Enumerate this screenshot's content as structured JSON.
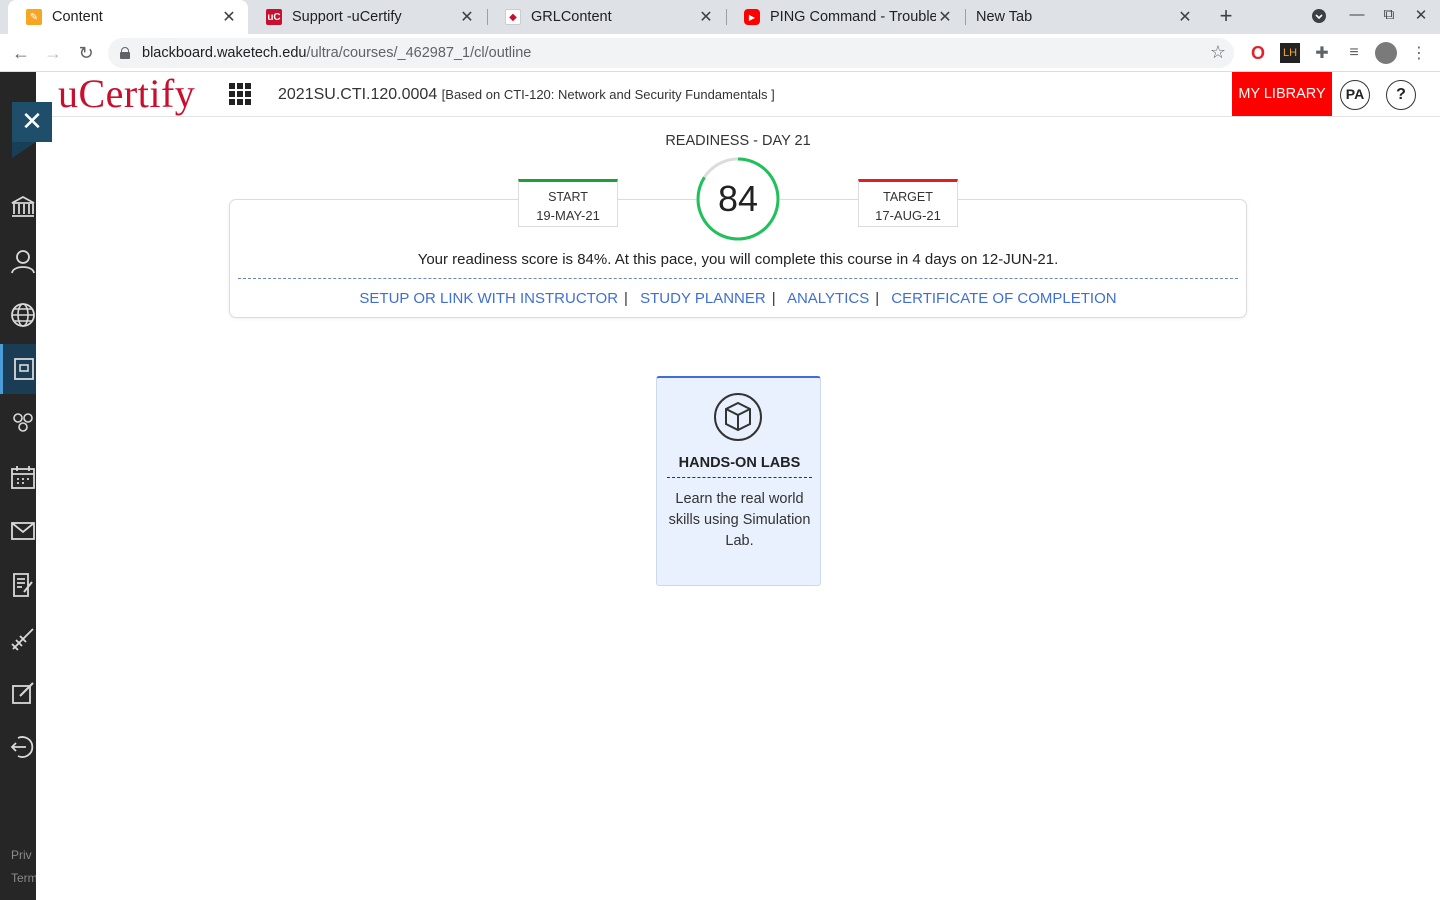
{
  "browser": {
    "tabs": [
      {
        "title": "Content",
        "favicon": "pencil-favicon",
        "active": true
      },
      {
        "title": "Support -uCertify",
        "favicon": "ucertify-favicon",
        "active": false
      },
      {
        "title": "GRLContent",
        "favicon": "grl-favicon",
        "active": false
      },
      {
        "title": "PING Command - Troubles",
        "favicon": "youtube-favicon",
        "active": false
      },
      {
        "title": "New Tab",
        "favicon": "none",
        "active": false
      }
    ],
    "url_host": "blackboard.waketech.edu",
    "url_path": "/ultra/courses/_462987_1/cl/outline"
  },
  "rail": {
    "items": [
      "institution-icon",
      "profile-icon",
      "globe-icon",
      "courses-icon",
      "groups-icon",
      "calendar-icon",
      "messages-icon",
      "grades-icon",
      "tools-icon",
      "edit-icon",
      "sign-out-icon"
    ],
    "footer_privacy": "Priv",
    "footer_terms": "Term"
  },
  "header": {
    "logo": "uCertify",
    "course_code": "2021SU.CTI.120.0004",
    "course_based_on": "[Based on CTI-120: Network and Security Fundamentals ]",
    "my_library": "MY LIBRARY",
    "avatar_initials": "PA",
    "help": "?"
  },
  "readiness": {
    "title": "READINESS - DAY 21",
    "score": "84",
    "score_fraction": 0.84,
    "start_label": "START",
    "start_date": "19-MAY-21",
    "target_label": "TARGET",
    "target_date": "17-AUG-21",
    "message": "Your readiness score is 84%. At this pace, you will complete this course in 4 days on 12-JUN-21.",
    "links": [
      "SETUP OR LINK WITH INSTRUCTOR",
      "STUDY PLANNER",
      "ANALYTICS",
      "CERTIFICATE OF COMPLETION"
    ]
  },
  "labs": {
    "title": "HANDS-ON LABS",
    "description": "Learn the real world skills using Simulation Lab."
  },
  "colors": {
    "brand_red": "#c8102e",
    "library_red": "#ff0000",
    "link_blue": "#3f6fd4",
    "score_green": "#1fc15a",
    "start_green": "#1e9e3a",
    "target_red": "#e02020",
    "rail_bg": "#262626",
    "close_panel": "#1f4e6b"
  }
}
